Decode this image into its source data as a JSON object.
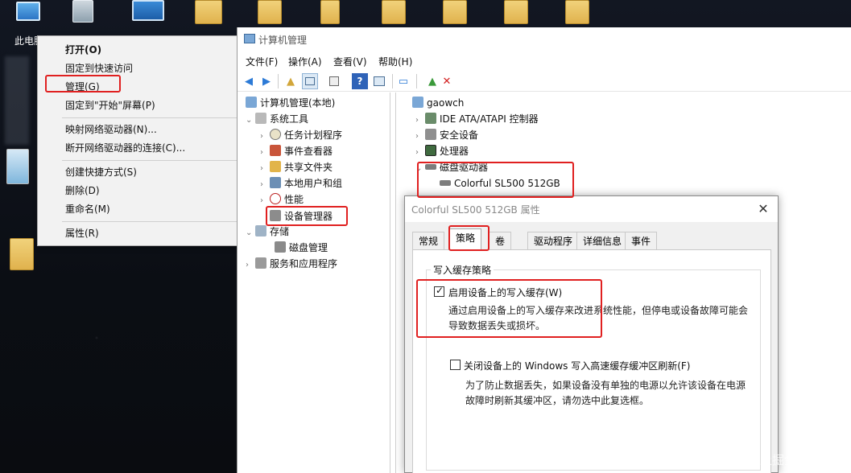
{
  "desktop": {
    "icons": [
      {
        "label": "此电脑",
        "icon": "this-pc-icon"
      },
      {
        "label": "",
        "icon": "recycle-bin-icon"
      },
      {
        "label": "",
        "icon": "control-panel-icon"
      }
    ]
  },
  "context_menu": {
    "items": [
      {
        "label": "打开(O)",
        "bold": true
      },
      {
        "label": "固定到快速访问"
      },
      {
        "label": "管理(G)"
      },
      {
        "label": "固定到\"开始\"屏幕(P)"
      },
      {
        "label": "映射网络驱动器(N)..."
      },
      {
        "label": "断开网络驱动器的连接(C)..."
      },
      {
        "label": "创建快捷方式(S)"
      },
      {
        "label": "删除(D)"
      },
      {
        "label": "重命名(M)"
      },
      {
        "label": "属性(R)"
      }
    ]
  },
  "computer_management": {
    "title": "计算机管理",
    "menu": [
      "文件(F)",
      "操作(A)",
      "查看(V)",
      "帮助(H)"
    ],
    "tree": {
      "root": "计算机管理(本地)",
      "system_tools": "系统工具",
      "task_scheduler": "任务计划程序",
      "event_viewer": "事件查看器",
      "shared_folders": "共享文件夹",
      "local_users": "本地用户和组",
      "performance": "性能",
      "device_manager": "设备管理器",
      "storage": "存储",
      "disk_management": "磁盘管理",
      "services": "服务和应用程序"
    },
    "devices": {
      "computer": "gaowch",
      "ide": "IDE ATA/ATAPI 控制器",
      "security": "安全设备",
      "processor": "处理器",
      "disk_drives": "磁盘驱动器",
      "disk": "Colorful SL500 512GB"
    }
  },
  "properties_dialog": {
    "title": "Colorful SL500 512GB 属性",
    "tabs": [
      "常规",
      "策略",
      "卷",
      "驱动程序",
      "详细信息",
      "事件"
    ],
    "active_tab": "策略",
    "group_title": "写入缓存策略",
    "write_cache": {
      "label": "启用设备上的写入缓存(W)",
      "checked": true,
      "desc_line1": "通过启用设备上的写入缓存来改进系统性能，但停电或设备故障可能会",
      "desc_line2": "导致数据丢失或损坏。"
    },
    "flush": {
      "label": "关闭设备上的 Windows 写入高速缓存缓冲区刷新(F)",
      "checked": false,
      "desc_line1": "为了防止数据丢失，如果设备没有单独的电源以允许该设备在电源",
      "desc_line2": "故障时刷新其缓冲区，请勿选中此复选框。"
    }
  },
  "watermark": "@稀土掘金技术社区"
}
